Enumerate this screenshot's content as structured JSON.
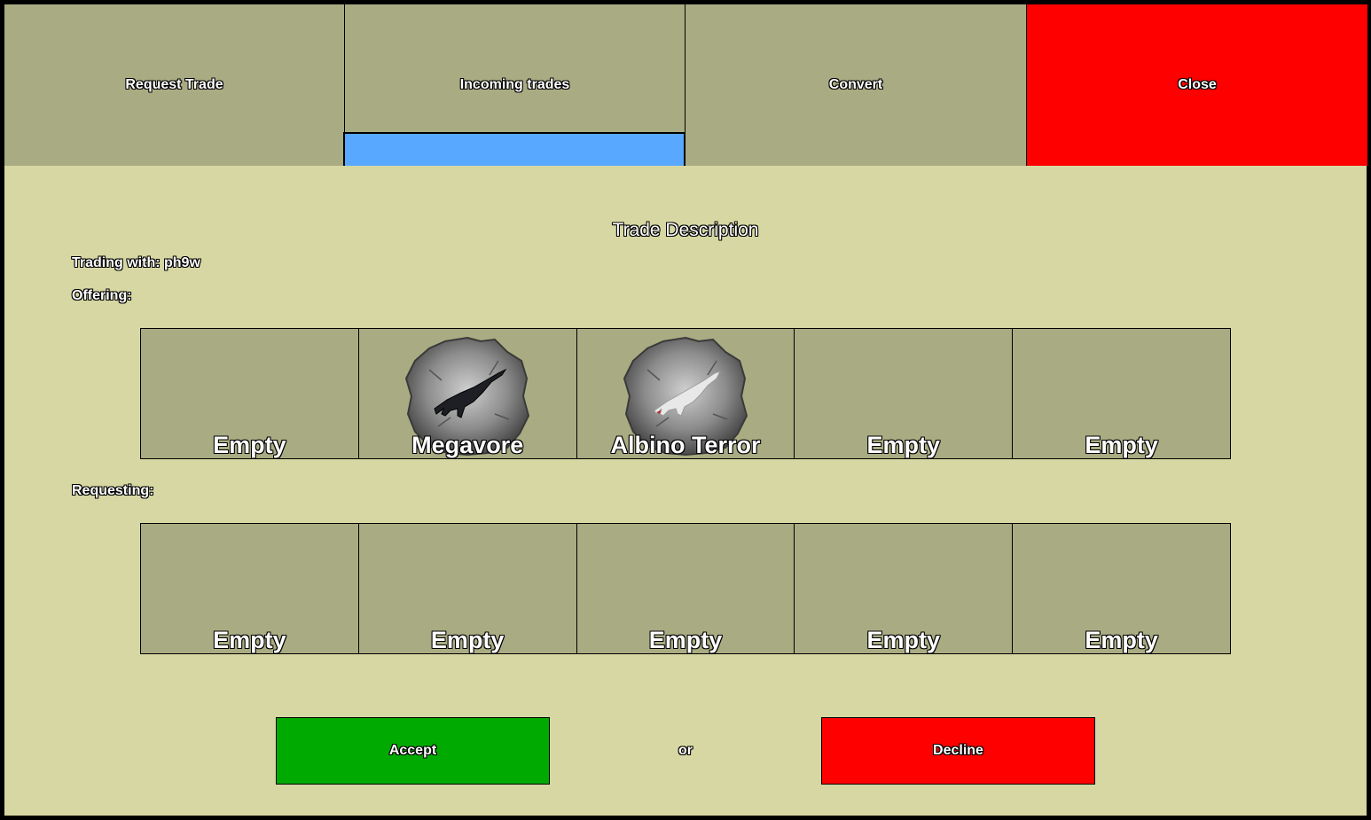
{
  "tabs": {
    "request_trade": "Request Trade",
    "incoming_trades": "Incoming trades",
    "convert": "Convert",
    "close": "Close"
  },
  "title": "Trade Description",
  "trading_with": "Trading with: ph9w",
  "offering_label": "Offering:",
  "requesting_label": "Requesting:",
  "offering": [
    {
      "name": "Empty",
      "portrait": ""
    },
    {
      "name": "Megavore",
      "portrait": "megavore-portrait"
    },
    {
      "name": "Albino Terror",
      "portrait": "albino-terror-portrait"
    },
    {
      "name": "Empty",
      "portrait": ""
    },
    {
      "name": "Empty",
      "portrait": ""
    }
  ],
  "requesting": [
    {
      "name": "Empty"
    },
    {
      "name": "Empty"
    },
    {
      "name": "Empty"
    },
    {
      "name": "Empty"
    },
    {
      "name": "Empty"
    }
  ],
  "actions": {
    "accept": "Accept",
    "or": "or",
    "decline": "Decline"
  },
  "colors": {
    "background": "#d6d7a2",
    "panel": "#a9ab82",
    "active_tab_indicator": "#58a8ff",
    "accept": "#00aa00",
    "danger": "#ff0000"
  }
}
